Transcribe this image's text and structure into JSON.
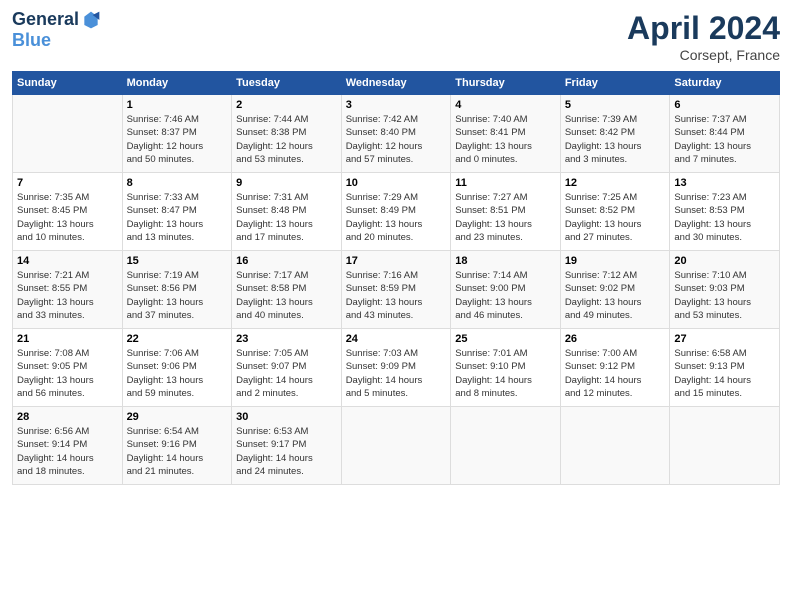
{
  "header": {
    "logo_line1": "General",
    "logo_line2": "Blue",
    "title": "April 2024",
    "subtitle": "Corsept, France"
  },
  "days_of_week": [
    "Sunday",
    "Monday",
    "Tuesday",
    "Wednesday",
    "Thursday",
    "Friday",
    "Saturday"
  ],
  "weeks": [
    [
      {
        "day": "",
        "info": ""
      },
      {
        "day": "1",
        "info": "Sunrise: 7:46 AM\nSunset: 8:37 PM\nDaylight: 12 hours\nand 50 minutes."
      },
      {
        "day": "2",
        "info": "Sunrise: 7:44 AM\nSunset: 8:38 PM\nDaylight: 12 hours\nand 53 minutes."
      },
      {
        "day": "3",
        "info": "Sunrise: 7:42 AM\nSunset: 8:40 PM\nDaylight: 12 hours\nand 57 minutes."
      },
      {
        "day": "4",
        "info": "Sunrise: 7:40 AM\nSunset: 8:41 PM\nDaylight: 13 hours\nand 0 minutes."
      },
      {
        "day": "5",
        "info": "Sunrise: 7:39 AM\nSunset: 8:42 PM\nDaylight: 13 hours\nand 3 minutes."
      },
      {
        "day": "6",
        "info": "Sunrise: 7:37 AM\nSunset: 8:44 PM\nDaylight: 13 hours\nand 7 minutes."
      }
    ],
    [
      {
        "day": "7",
        "info": "Sunrise: 7:35 AM\nSunset: 8:45 PM\nDaylight: 13 hours\nand 10 minutes."
      },
      {
        "day": "8",
        "info": "Sunrise: 7:33 AM\nSunset: 8:47 PM\nDaylight: 13 hours\nand 13 minutes."
      },
      {
        "day": "9",
        "info": "Sunrise: 7:31 AM\nSunset: 8:48 PM\nDaylight: 13 hours\nand 17 minutes."
      },
      {
        "day": "10",
        "info": "Sunrise: 7:29 AM\nSunset: 8:49 PM\nDaylight: 13 hours\nand 20 minutes."
      },
      {
        "day": "11",
        "info": "Sunrise: 7:27 AM\nSunset: 8:51 PM\nDaylight: 13 hours\nand 23 minutes."
      },
      {
        "day": "12",
        "info": "Sunrise: 7:25 AM\nSunset: 8:52 PM\nDaylight: 13 hours\nand 27 minutes."
      },
      {
        "day": "13",
        "info": "Sunrise: 7:23 AM\nSunset: 8:53 PM\nDaylight: 13 hours\nand 30 minutes."
      }
    ],
    [
      {
        "day": "14",
        "info": "Sunrise: 7:21 AM\nSunset: 8:55 PM\nDaylight: 13 hours\nand 33 minutes."
      },
      {
        "day": "15",
        "info": "Sunrise: 7:19 AM\nSunset: 8:56 PM\nDaylight: 13 hours\nand 37 minutes."
      },
      {
        "day": "16",
        "info": "Sunrise: 7:17 AM\nSunset: 8:58 PM\nDaylight: 13 hours\nand 40 minutes."
      },
      {
        "day": "17",
        "info": "Sunrise: 7:16 AM\nSunset: 8:59 PM\nDaylight: 13 hours\nand 43 minutes."
      },
      {
        "day": "18",
        "info": "Sunrise: 7:14 AM\nSunset: 9:00 PM\nDaylight: 13 hours\nand 46 minutes."
      },
      {
        "day": "19",
        "info": "Sunrise: 7:12 AM\nSunset: 9:02 PM\nDaylight: 13 hours\nand 49 minutes."
      },
      {
        "day": "20",
        "info": "Sunrise: 7:10 AM\nSunset: 9:03 PM\nDaylight: 13 hours\nand 53 minutes."
      }
    ],
    [
      {
        "day": "21",
        "info": "Sunrise: 7:08 AM\nSunset: 9:05 PM\nDaylight: 13 hours\nand 56 minutes."
      },
      {
        "day": "22",
        "info": "Sunrise: 7:06 AM\nSunset: 9:06 PM\nDaylight: 13 hours\nand 59 minutes."
      },
      {
        "day": "23",
        "info": "Sunrise: 7:05 AM\nSunset: 9:07 PM\nDaylight: 14 hours\nand 2 minutes."
      },
      {
        "day": "24",
        "info": "Sunrise: 7:03 AM\nSunset: 9:09 PM\nDaylight: 14 hours\nand 5 minutes."
      },
      {
        "day": "25",
        "info": "Sunrise: 7:01 AM\nSunset: 9:10 PM\nDaylight: 14 hours\nand 8 minutes."
      },
      {
        "day": "26",
        "info": "Sunrise: 7:00 AM\nSunset: 9:12 PM\nDaylight: 14 hours\nand 12 minutes."
      },
      {
        "day": "27",
        "info": "Sunrise: 6:58 AM\nSunset: 9:13 PM\nDaylight: 14 hours\nand 15 minutes."
      }
    ],
    [
      {
        "day": "28",
        "info": "Sunrise: 6:56 AM\nSunset: 9:14 PM\nDaylight: 14 hours\nand 18 minutes."
      },
      {
        "day": "29",
        "info": "Sunrise: 6:54 AM\nSunset: 9:16 PM\nDaylight: 14 hours\nand 21 minutes."
      },
      {
        "day": "30",
        "info": "Sunrise: 6:53 AM\nSunset: 9:17 PM\nDaylight: 14 hours\nand 24 minutes."
      },
      {
        "day": "",
        "info": ""
      },
      {
        "day": "",
        "info": ""
      },
      {
        "day": "",
        "info": ""
      },
      {
        "day": "",
        "info": ""
      }
    ]
  ]
}
